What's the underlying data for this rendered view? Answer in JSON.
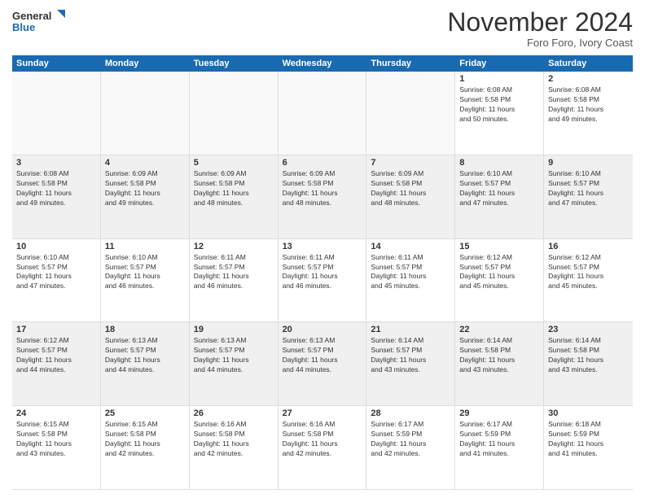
{
  "header": {
    "logo_line1": "General",
    "logo_line2": "Blue",
    "month_title": "November 2024",
    "location": "Foro Foro, Ivory Coast"
  },
  "weekdays": [
    "Sunday",
    "Monday",
    "Tuesday",
    "Wednesday",
    "Thursday",
    "Friday",
    "Saturday"
  ],
  "rows": [
    [
      {
        "day": "",
        "info": ""
      },
      {
        "day": "",
        "info": ""
      },
      {
        "day": "",
        "info": ""
      },
      {
        "day": "",
        "info": ""
      },
      {
        "day": "",
        "info": ""
      },
      {
        "day": "1",
        "info": "Sunrise: 6:08 AM\nSunset: 5:58 PM\nDaylight: 11 hours\nand 50 minutes."
      },
      {
        "day": "2",
        "info": "Sunrise: 6:08 AM\nSunset: 5:58 PM\nDaylight: 11 hours\nand 49 minutes."
      }
    ],
    [
      {
        "day": "3",
        "info": "Sunrise: 6:08 AM\nSunset: 5:58 PM\nDaylight: 11 hours\nand 49 minutes."
      },
      {
        "day": "4",
        "info": "Sunrise: 6:09 AM\nSunset: 5:58 PM\nDaylight: 11 hours\nand 49 minutes."
      },
      {
        "day": "5",
        "info": "Sunrise: 6:09 AM\nSunset: 5:58 PM\nDaylight: 11 hours\nand 48 minutes."
      },
      {
        "day": "6",
        "info": "Sunrise: 6:09 AM\nSunset: 5:58 PM\nDaylight: 11 hours\nand 48 minutes."
      },
      {
        "day": "7",
        "info": "Sunrise: 6:09 AM\nSunset: 5:58 PM\nDaylight: 11 hours\nand 48 minutes."
      },
      {
        "day": "8",
        "info": "Sunrise: 6:10 AM\nSunset: 5:57 PM\nDaylight: 11 hours\nand 47 minutes."
      },
      {
        "day": "9",
        "info": "Sunrise: 6:10 AM\nSunset: 5:57 PM\nDaylight: 11 hours\nand 47 minutes."
      }
    ],
    [
      {
        "day": "10",
        "info": "Sunrise: 6:10 AM\nSunset: 5:57 PM\nDaylight: 11 hours\nand 47 minutes."
      },
      {
        "day": "11",
        "info": "Sunrise: 6:10 AM\nSunset: 5:57 PM\nDaylight: 11 hours\nand 46 minutes."
      },
      {
        "day": "12",
        "info": "Sunrise: 6:11 AM\nSunset: 5:57 PM\nDaylight: 11 hours\nand 46 minutes."
      },
      {
        "day": "13",
        "info": "Sunrise: 6:11 AM\nSunset: 5:57 PM\nDaylight: 11 hours\nand 46 minutes."
      },
      {
        "day": "14",
        "info": "Sunrise: 6:11 AM\nSunset: 5:57 PM\nDaylight: 11 hours\nand 45 minutes."
      },
      {
        "day": "15",
        "info": "Sunrise: 6:12 AM\nSunset: 5:57 PM\nDaylight: 11 hours\nand 45 minutes."
      },
      {
        "day": "16",
        "info": "Sunrise: 6:12 AM\nSunset: 5:57 PM\nDaylight: 11 hours\nand 45 minutes."
      }
    ],
    [
      {
        "day": "17",
        "info": "Sunrise: 6:12 AM\nSunset: 5:57 PM\nDaylight: 11 hours\nand 44 minutes."
      },
      {
        "day": "18",
        "info": "Sunrise: 6:13 AM\nSunset: 5:57 PM\nDaylight: 11 hours\nand 44 minutes."
      },
      {
        "day": "19",
        "info": "Sunrise: 6:13 AM\nSunset: 5:57 PM\nDaylight: 11 hours\nand 44 minutes."
      },
      {
        "day": "20",
        "info": "Sunrise: 6:13 AM\nSunset: 5:57 PM\nDaylight: 11 hours\nand 44 minutes."
      },
      {
        "day": "21",
        "info": "Sunrise: 6:14 AM\nSunset: 5:57 PM\nDaylight: 11 hours\nand 43 minutes."
      },
      {
        "day": "22",
        "info": "Sunrise: 6:14 AM\nSunset: 5:58 PM\nDaylight: 11 hours\nand 43 minutes."
      },
      {
        "day": "23",
        "info": "Sunrise: 6:14 AM\nSunset: 5:58 PM\nDaylight: 11 hours\nand 43 minutes."
      }
    ],
    [
      {
        "day": "24",
        "info": "Sunrise: 6:15 AM\nSunset: 5:58 PM\nDaylight: 11 hours\nand 43 minutes."
      },
      {
        "day": "25",
        "info": "Sunrise: 6:15 AM\nSunset: 5:58 PM\nDaylight: 11 hours\nand 42 minutes."
      },
      {
        "day": "26",
        "info": "Sunrise: 6:16 AM\nSunset: 5:58 PM\nDaylight: 11 hours\nand 42 minutes."
      },
      {
        "day": "27",
        "info": "Sunrise: 6:16 AM\nSunset: 5:58 PM\nDaylight: 11 hours\nand 42 minutes."
      },
      {
        "day": "28",
        "info": "Sunrise: 6:17 AM\nSunset: 5:59 PM\nDaylight: 11 hours\nand 42 minutes."
      },
      {
        "day": "29",
        "info": "Sunrise: 6:17 AM\nSunset: 5:59 PM\nDaylight: 11 hours\nand 41 minutes."
      },
      {
        "day": "30",
        "info": "Sunrise: 6:18 AM\nSunset: 5:59 PM\nDaylight: 11 hours\nand 41 minutes."
      }
    ]
  ]
}
